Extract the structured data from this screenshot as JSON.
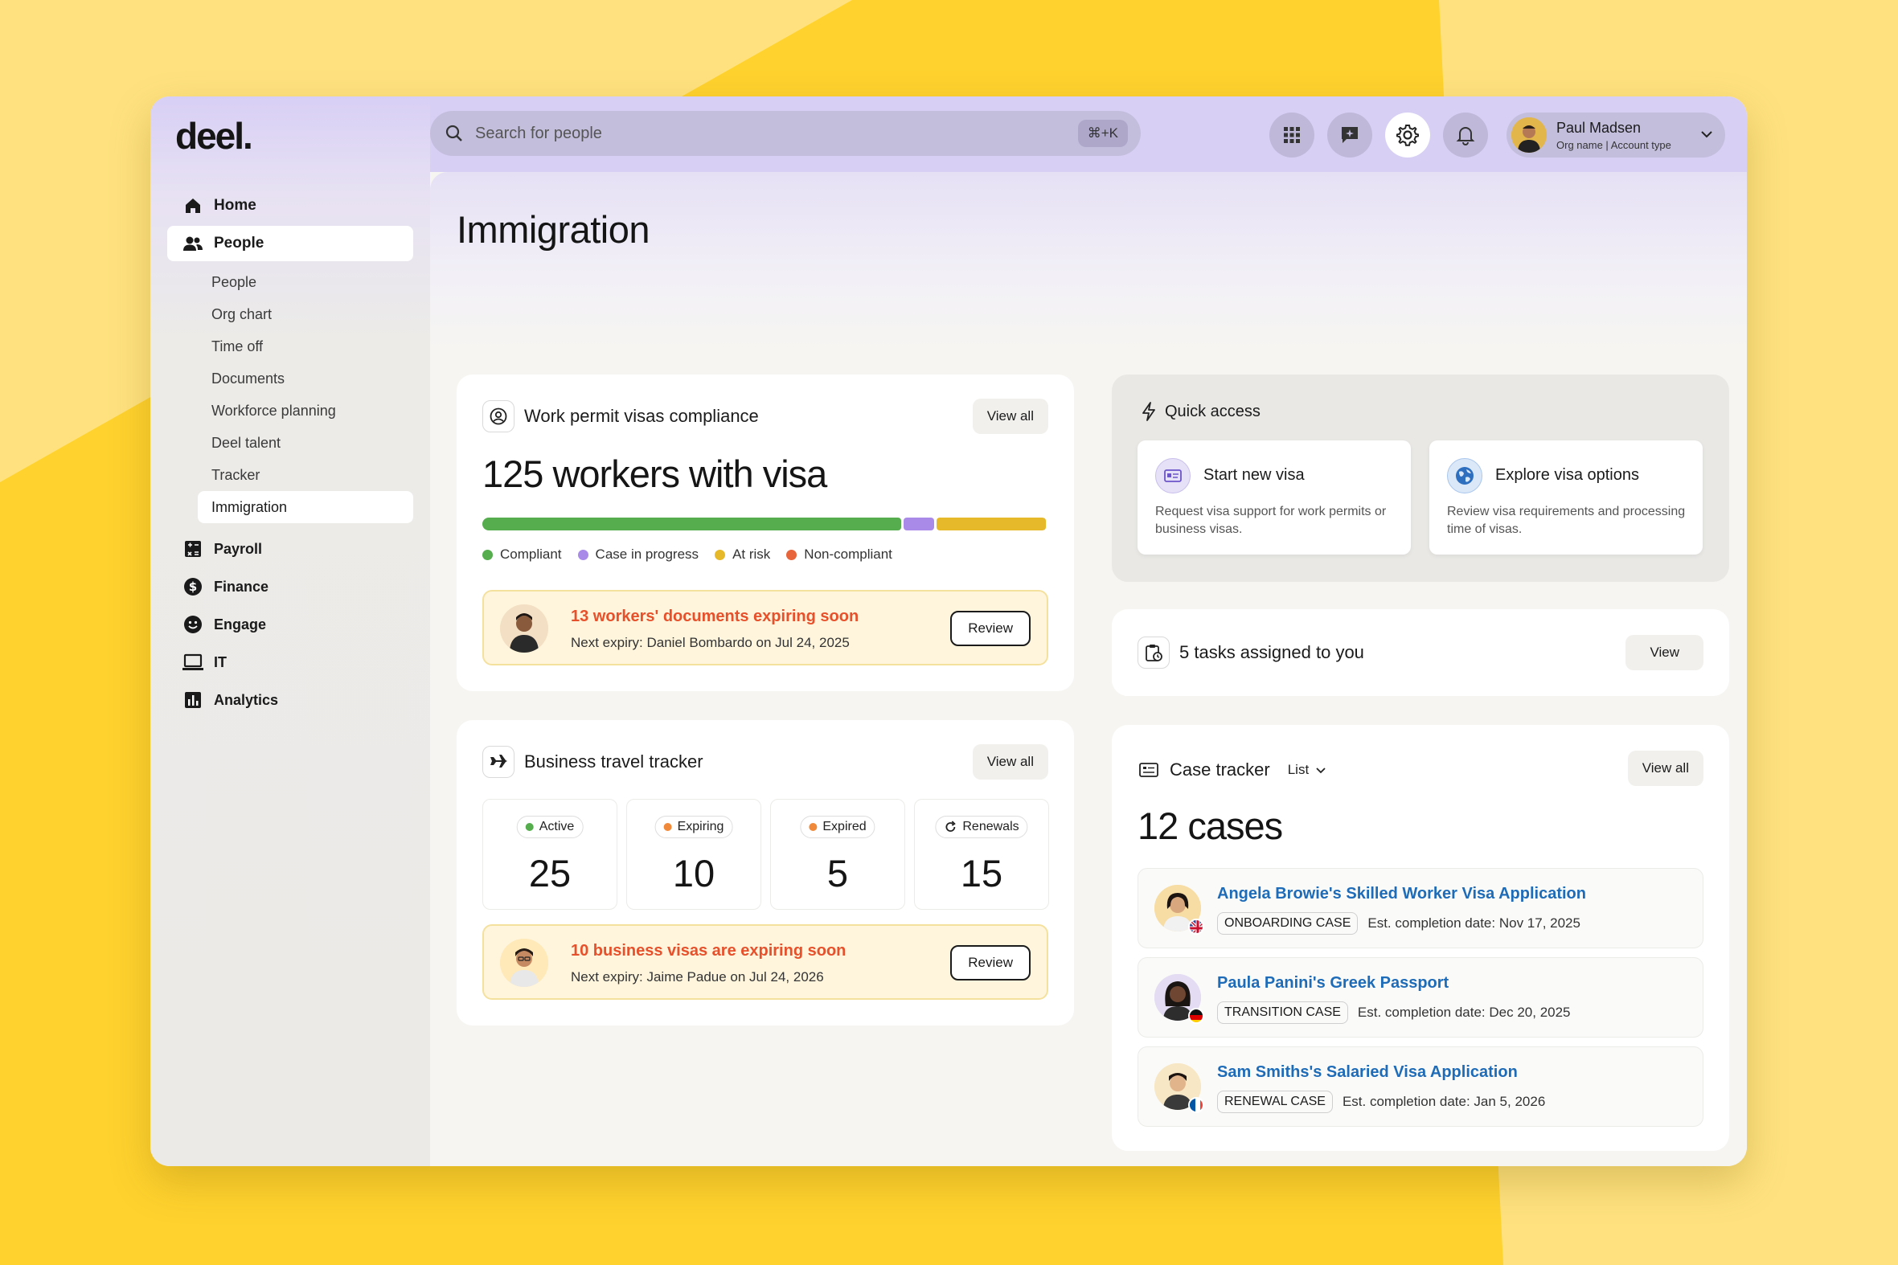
{
  "app": {
    "logo": "deel."
  },
  "search": {
    "placeholder": "Search for people",
    "shortcut": "⌘+K"
  },
  "user": {
    "name": "Paul Madsen",
    "org": "Org name",
    "account": "Account type"
  },
  "sidebar": {
    "primary": [
      {
        "label": "Home",
        "icon": "home-icon"
      },
      {
        "label": "People",
        "icon": "people-icon",
        "active": true
      }
    ],
    "people_sub": [
      "People",
      "Org chart",
      "Time off",
      "Documents",
      "Workforce planning",
      "Deel talent",
      "Tracker",
      "Immigration"
    ],
    "active_sub": "Immigration",
    "secondary": [
      {
        "label": "Payroll",
        "icon": "calculator-icon"
      },
      {
        "label": "Finance",
        "icon": "dollar-icon"
      },
      {
        "label": "Engage",
        "icon": "smile-icon"
      },
      {
        "label": "IT",
        "icon": "laptop-icon"
      },
      {
        "label": "Analytics",
        "icon": "chart-icon"
      }
    ]
  },
  "page": {
    "title": "Immigration"
  },
  "compliance": {
    "title": "Work permit visas compliance",
    "view_all": "View all",
    "headline": "125 workers with visa",
    "segments": [
      {
        "label": "Compliant",
        "fraction": 0.75,
        "color": "#55ad4e"
      },
      {
        "label": "Case in progress",
        "fraction": 0.055,
        "color": "#a98ae8"
      },
      {
        "label": "At risk",
        "fraction": 0.195,
        "color": "#e6b92a"
      },
      {
        "label": "Non-compliant",
        "fraction": 0.0,
        "color": "#e8643a"
      }
    ],
    "alert": {
      "title": "13 workers' documents expiring soon",
      "sub": "Next expiry: Daniel Bombardo on Jul 24, 2025",
      "action": "Review"
    }
  },
  "travel": {
    "title": "Business travel tracker",
    "view_all": "View all",
    "stats": [
      {
        "label": "Active",
        "value": "25",
        "dot": "#55ad4e"
      },
      {
        "label": "Expiring",
        "value": "10",
        "dot": "#f08a3a"
      },
      {
        "label": "Expired",
        "value": "5",
        "dot": "#f08a3a"
      },
      {
        "label": "Renewals",
        "value": "15",
        "dot": ""
      }
    ],
    "alert": {
      "title": "10 business visas are expiring soon",
      "sub": "Next expiry: Jaime Padue on Jul 24, 2026",
      "action": "Review"
    }
  },
  "quick_access": {
    "title": "Quick access",
    "cards": [
      {
        "title": "Start new visa",
        "desc": "Request visa support for work permits or business visas."
      },
      {
        "title": "Explore visa options",
        "desc": "Review visa requirements and processing time of visas."
      }
    ]
  },
  "tasks": {
    "title": "5 tasks assigned to you",
    "action": "View"
  },
  "cases": {
    "title": "Case tracker",
    "mode": "List",
    "view_all": "View all",
    "headline": "12 cases",
    "items": [
      {
        "title": "Angela Browie's Skilled Worker Visa Application",
        "tag": "ONBOARDING CASE",
        "date": "Est. completion date: Nov 17, 2025"
      },
      {
        "title": "Paula Panini's Greek Passport",
        "tag": "TRANSITION CASE",
        "date": "Est. completion date: Dec 20, 2025"
      },
      {
        "title": "Sam Smiths's Salaried Visa Application",
        "tag": "RENEWAL CASE",
        "date": "Est. completion date: Jan 5, 2026"
      }
    ]
  },
  "colors": {
    "accent_purple": "#d8cff5",
    "alert_orange": "#e6502a",
    "link_blue": "#1e6bb8",
    "background_yellow": "#ffd22e"
  }
}
